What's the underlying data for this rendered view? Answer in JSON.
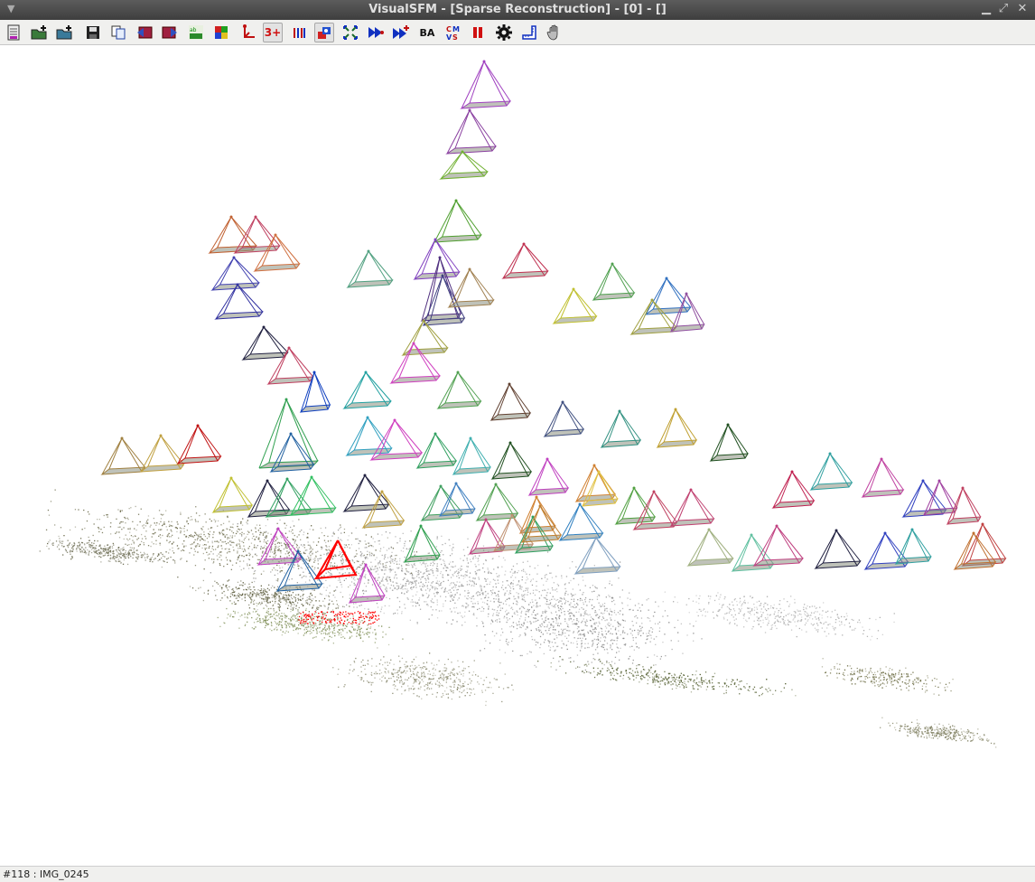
{
  "window": {
    "title": "VisualSFM - [Sparse Reconstruction] - [0] - []"
  },
  "toolbar": {
    "items": [
      {
        "name": "log-window-icon"
      },
      {
        "name": "open-multi-images-icon"
      },
      {
        "name": "open-add-images-icon"
      },
      {
        "name": "save-nvm-icon"
      },
      {
        "name": "copy-icon"
      },
      {
        "name": "previous-icon"
      },
      {
        "name": "next-icon"
      },
      {
        "name": "thumbnail-view-icon"
      },
      {
        "name": "color-grid-icon"
      },
      {
        "name": "axis-icon"
      },
      {
        "name": "min-track-button",
        "label": "3+"
      },
      {
        "name": "feature-match-icon"
      },
      {
        "name": "show-cameras-icon"
      },
      {
        "name": "compute-missing-match-icon"
      },
      {
        "name": "compute-3d-icon"
      },
      {
        "name": "compute-3d-add-icon"
      },
      {
        "name": "bundle-adjust-button",
        "label": "BA"
      },
      {
        "name": "dense-reconstruction-icon"
      },
      {
        "name": "pause-icon"
      },
      {
        "name": "settings-gear-icon"
      },
      {
        "name": "ruler-icon"
      },
      {
        "name": "hand-pan-icon"
      }
    ],
    "labels": {
      "min_track": "3+",
      "ba": "BA"
    }
  },
  "status": {
    "text": "#118 : IMG_0245"
  },
  "colors": {
    "selected_camera": "#ff0000",
    "titlebar": "#4a4a4a",
    "toolbar": "#f0f0ee"
  }
}
